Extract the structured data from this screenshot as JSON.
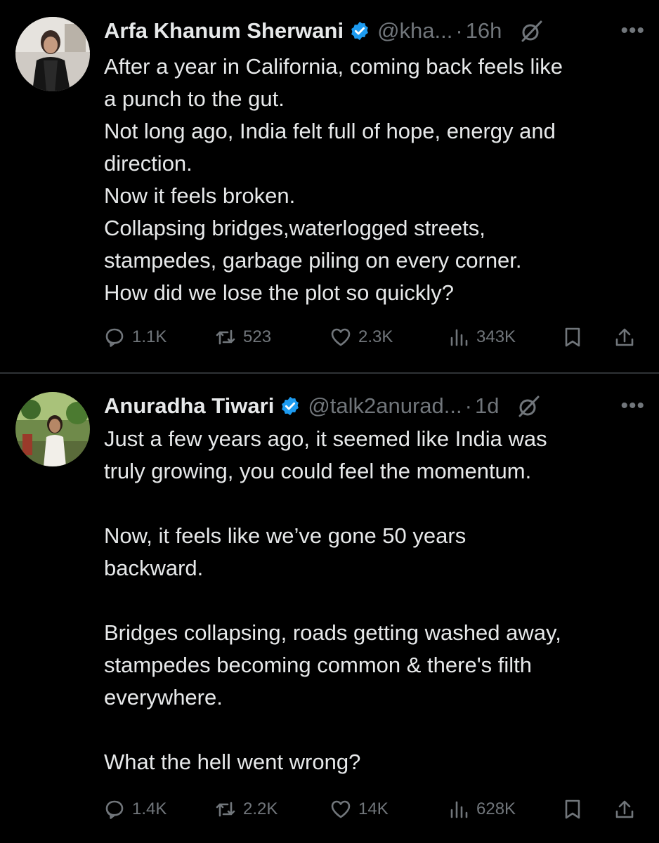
{
  "tweets": [
    {
      "name": "Arfa Khanum Sherwani",
      "handle": "@kha...",
      "dot": "·",
      "time": "16h",
      "more": "•••",
      "lines": [
        "After a year in California, coming back feels like",
        "a punch to the gut.",
        "Not long ago, India felt full of hope, energy and",
        "direction.",
        "Now it feels broken.",
        "Collapsing bridges,waterlogged streets,",
        "stampedes, garbage piling on every corner.",
        "How did we lose the plot so quickly?"
      ],
      "stats": {
        "replies": "1.1K",
        "reposts": "523",
        "likes": "2.3K",
        "views": "343K"
      }
    },
    {
      "name": "Anuradha Tiwari",
      "handle": "@talk2anurad...",
      "dot": "·",
      "time": "1d",
      "more": "•••",
      "lines": [
        "Just a few years ago, it seemed like India was",
        "truly growing, you could feel the momentum.",
        "",
        "Now, it feels like we’ve gone 50 years",
        "backward.",
        "",
        "Bridges collapsing, roads getting washed away,",
        "stampedes becoming common & there's filth",
        "everywhere.",
        "",
        "What the hell went wrong?"
      ],
      "stats": {
        "replies": "1.4K",
        "reposts": "2.2K",
        "likes": "14K",
        "views": "628K"
      }
    }
  ],
  "colors": {
    "background": "#000000",
    "text": "#e7e9ea",
    "secondary": "#71767b",
    "verified": "#1d9bf0",
    "divider": "#2f3336"
  },
  "icons": [
    "verified-badge-icon",
    "grok-icon",
    "more-icon",
    "reply-icon",
    "repost-icon",
    "like-icon",
    "views-icon",
    "bookmark-icon",
    "share-icon"
  ]
}
